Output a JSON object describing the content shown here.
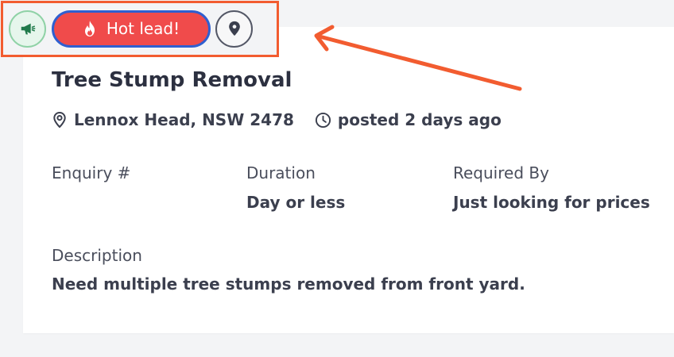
{
  "badges": {
    "hot_lead_label": "Hot lead!",
    "icons": [
      "megaphone-icon",
      "fire-icon",
      "location-pin-icon"
    ]
  },
  "job": {
    "title": "Tree Stump Removal",
    "location": "Lennox Head, NSW 2478",
    "posted": "posted 2 days ago"
  },
  "fields": {
    "enquiry_label": "Enquiry #",
    "enquiry_value": "",
    "duration_label": "Duration",
    "duration_value": "Day or less",
    "required_by_label": "Required By",
    "required_by_value": "Just looking for prices",
    "description_label": "Description",
    "description_value": "Need multiple tree stumps removed from front yard."
  },
  "colors": {
    "annotation": "#f25c30",
    "hot_lead_bg": "#f04b4b",
    "hot_lead_border": "#2f5fd0",
    "megaphone": "#1f7a4a"
  }
}
